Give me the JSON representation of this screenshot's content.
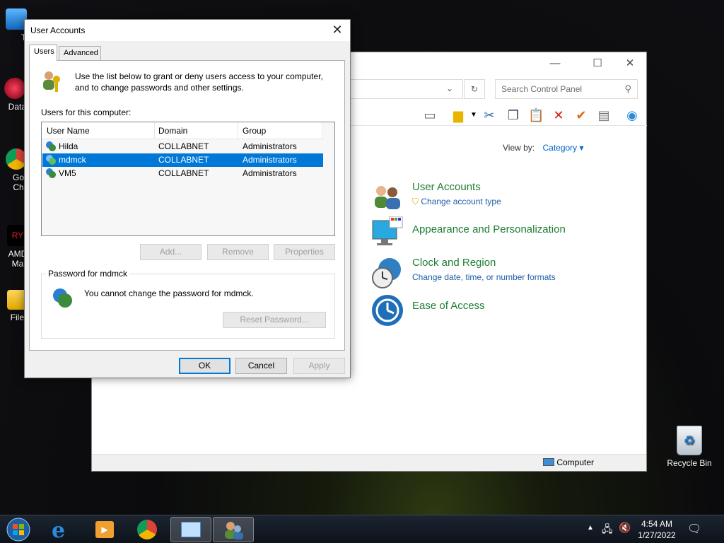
{
  "desktop": {
    "icons": [
      {
        "label": "Th",
        "icon": "this-pc-icon"
      },
      {
        "label": "DataW",
        "icon": "datawedge-icon"
      },
      {
        "label": "Go Ch",
        "icon": "google-chrome-icon"
      },
      {
        "label": "AMD Ma",
        "icon": "amd-icon"
      },
      {
        "label": "File E",
        "icon": "file-explorer-icon"
      },
      {
        "label": "Recycle Bin",
        "icon": "recycle-bin-icon"
      }
    ]
  },
  "control_panel": {
    "search_placeholder": "Search Control Panel",
    "view_by_label": "View by:",
    "view_by_value": "Category",
    "categories": [
      {
        "title": "User Accounts",
        "link": "Change account type"
      },
      {
        "title": "Appearance and Personalization",
        "link": ""
      },
      {
        "title": "Clock and Region",
        "link": "Change date, time, or number formats"
      },
      {
        "title": "Ease of Access",
        "link": ""
      }
    ],
    "status_text": "Computer"
  },
  "user_accounts_dialog": {
    "title": "User Accounts",
    "tabs": [
      {
        "label": "Users",
        "active": true
      },
      {
        "label": "Advanced",
        "active": false
      }
    ],
    "info_text": "Use the list below to grant or deny users access to your computer, and to change passwords and other settings.",
    "users_label": "Users for this computer:",
    "columns": [
      "User Name",
      "Domain",
      "Group"
    ],
    "rows": [
      {
        "name": "Hilda",
        "domain": "COLLABNET",
        "group": "Administrators",
        "selected": false
      },
      {
        "name": "mdmck",
        "domain": "COLLABNET",
        "group": "Administrators",
        "selected": true
      },
      {
        "name": "VM5",
        "domain": "COLLABNET",
        "group": "Administrators",
        "selected": false
      }
    ],
    "buttons": {
      "add": "Add...",
      "remove": "Remove",
      "properties": "Properties"
    },
    "password_group_label": "Password for mdmck",
    "password_text": "You cannot change the password for mdmck.",
    "reset_password": "Reset Password...",
    "ok": "OK",
    "cancel": "Cancel",
    "apply": "Apply"
  },
  "taskbar": {
    "time": "4:54 AM",
    "date": "1/27/2022"
  },
  "colors": {
    "accent": "#0078d7",
    "category_title": "#1e7e34",
    "link": "#1f5fa8"
  }
}
